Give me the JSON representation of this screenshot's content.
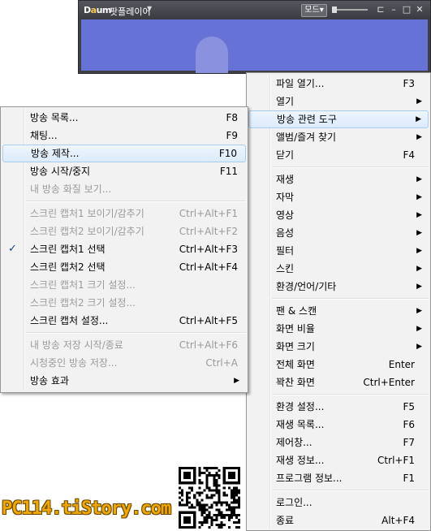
{
  "window": {
    "logo_text": "Daum",
    "title": "팟플레이어",
    "mode_button": "모드"
  },
  "context_menu": [
    {
      "label": "파일 열기...",
      "shortcut": "F3"
    },
    {
      "label": "열기",
      "submenu": true
    },
    {
      "label": "방송 관련 도구",
      "submenu": true,
      "highlighted": true
    },
    {
      "label": "앨범/즐겨 찾기",
      "submenu": true
    },
    {
      "label": "닫기",
      "shortcut": "F4"
    },
    {
      "separator": true
    },
    {
      "label": "재생",
      "submenu": true
    },
    {
      "label": "자막",
      "submenu": true
    },
    {
      "label": "영상",
      "submenu": true
    },
    {
      "label": "음성",
      "submenu": true
    },
    {
      "label": "필터",
      "submenu": true
    },
    {
      "label": "스킨",
      "submenu": true
    },
    {
      "label": "환경/언어/기타",
      "submenu": true
    },
    {
      "separator": true
    },
    {
      "label": "팬 & 스캔",
      "submenu": true
    },
    {
      "label": "화면 비율",
      "submenu": true
    },
    {
      "label": "화면 크기",
      "submenu": true
    },
    {
      "label": "전체 화면",
      "shortcut": "Enter"
    },
    {
      "label": "꽉찬 화면",
      "shortcut": "Ctrl+Enter"
    },
    {
      "separator": true
    },
    {
      "label": "환경 설정...",
      "shortcut": "F5"
    },
    {
      "label": "재생 목록...",
      "shortcut": "F6"
    },
    {
      "label": "제어창...",
      "shortcut": "F7"
    },
    {
      "label": "재생 정보...",
      "shortcut": "Ctrl+F1"
    },
    {
      "label": "프로그램 정보...",
      "shortcut": "F1"
    },
    {
      "separator": true
    },
    {
      "label": "로그인..."
    },
    {
      "label": "종료",
      "shortcut": "Alt+F4"
    }
  ],
  "broadcast_submenu": [
    {
      "label": "방송 목록...",
      "shortcut": "F8"
    },
    {
      "label": "채팅...",
      "shortcut": "F9"
    },
    {
      "label": "방송 제작...",
      "shortcut": "F10",
      "highlighted": true
    },
    {
      "label": "방송 시작/중지",
      "shortcut": "F11"
    },
    {
      "label": "내 방송 화질 보기...",
      "disabled": true
    },
    {
      "separator": true
    },
    {
      "label": "스크린 캡처1 보이기/감추기",
      "shortcut": "Ctrl+Alt+F1",
      "disabled": true
    },
    {
      "label": "스크린 캡처2 보이기/감추기",
      "shortcut": "Ctrl+Alt+F2",
      "disabled": true
    },
    {
      "label": "스크린 캡처1 선택",
      "shortcut": "Ctrl+Alt+F3",
      "checked": true
    },
    {
      "label": "스크린 캡처2 선택",
      "shortcut": "Ctrl+Alt+F4"
    },
    {
      "label": "스크린 캡처1 크기 설정...",
      "disabled": true
    },
    {
      "label": "스크린 캡처2 크기 설정...",
      "disabled": true
    },
    {
      "label": "스크린 캡처 설정...",
      "shortcut": "Ctrl+Alt+F5"
    },
    {
      "separator": true
    },
    {
      "label": "내 방송 저장 시작/종료",
      "shortcut": "Ctrl+Alt+F6",
      "disabled": true
    },
    {
      "label": "시청중인 방송 저장...",
      "shortcut": "Ctrl+A",
      "disabled": true
    },
    {
      "label": "방송 효과",
      "submenu": true
    }
  ],
  "watermark": "PC114.tiStory.com",
  "icons": {
    "submenu_arrow": "▶",
    "check": "✓",
    "minimize": "–",
    "maximize": "□",
    "close": "✕"
  }
}
